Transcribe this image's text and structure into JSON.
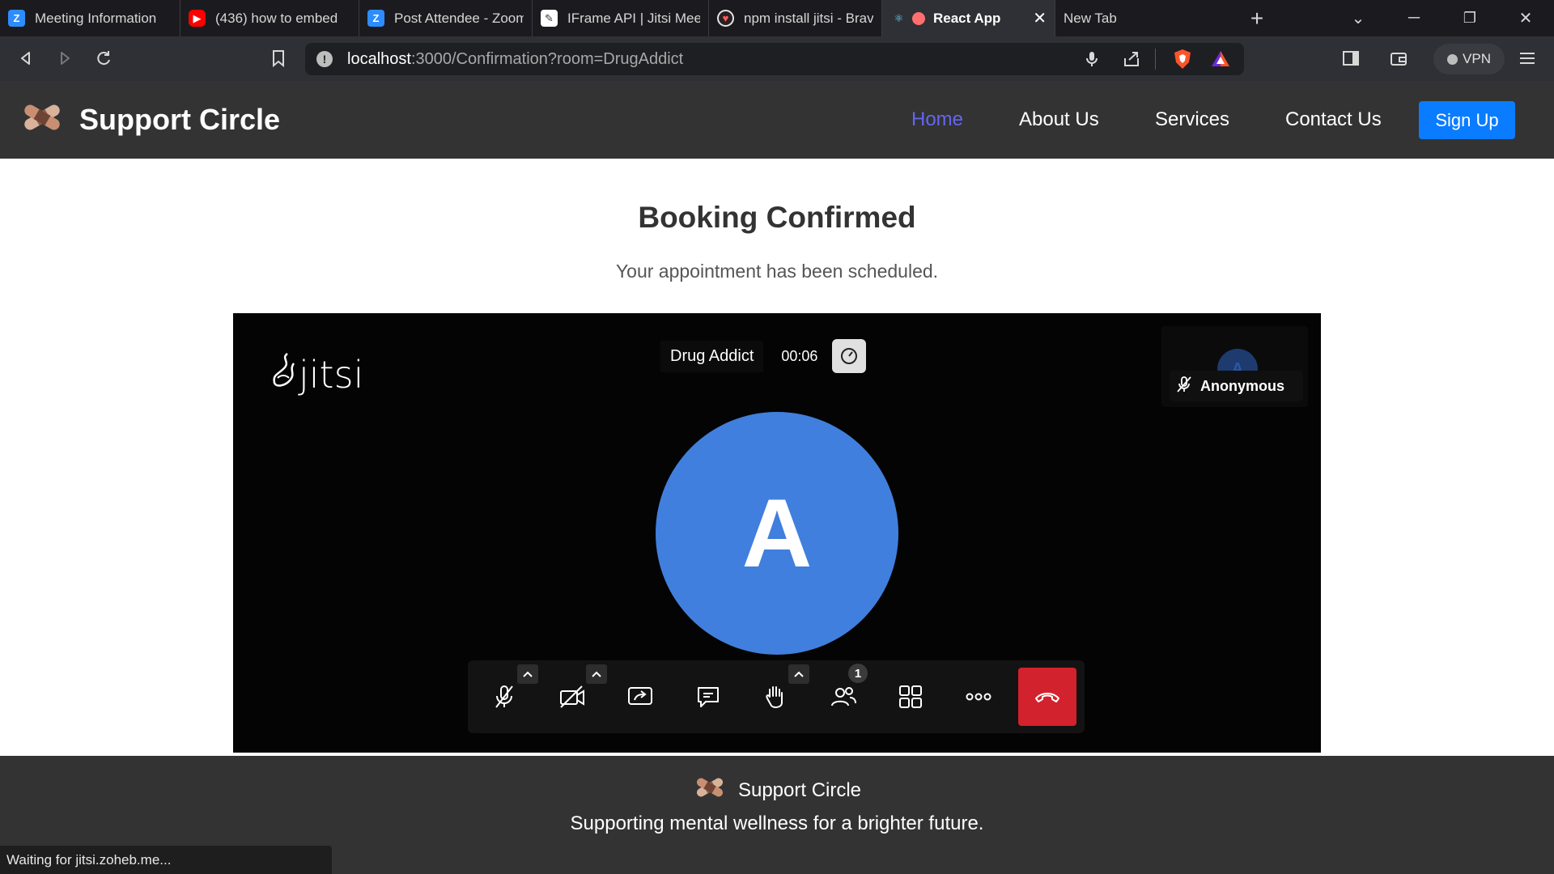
{
  "browser": {
    "tabs": [
      {
        "title": "Meeting Information",
        "favicon": "zoom-icon"
      },
      {
        "title": "(436) how to embed",
        "favicon": "youtube-icon"
      },
      {
        "title": "Post Attendee - Zoom",
        "favicon": "zoom-icon"
      },
      {
        "title": "IFrame API | Jitsi Meet",
        "favicon": "jitsi-icon"
      },
      {
        "title": "npm install jitsi - Brave",
        "favicon": "brave-search-icon"
      },
      {
        "title": "React App",
        "favicon": "react-icon",
        "active": true
      },
      {
        "title": "New Tab",
        "favicon": ""
      }
    ],
    "url_host": "localhost",
    "url_rest": ":3000/Confirmation?room=DrugAddict",
    "vpn_label": "VPN",
    "status_text": "Waiting for jitsi.zoheb.me..."
  },
  "navbar": {
    "brand": "Support Circle",
    "links": [
      "Home",
      "About Us",
      "Services",
      "Contact Us"
    ],
    "active_link": "Home",
    "signup": "Sign Up"
  },
  "page": {
    "title": "Booking Confirmed",
    "subtitle": "Your appointment has been scheduled."
  },
  "meeting": {
    "logo": "jitsi",
    "room_name": "Drug Addict",
    "timer": "00:06",
    "participant_name": "Anonymous",
    "avatar_letter": "A",
    "participant_count": "1"
  },
  "footer": {
    "brand": "Support Circle",
    "tagline": "Supporting mental wellness for a brighter future."
  },
  "colors": {
    "navbar": "#333333",
    "active_link": "#6366f1",
    "signup": "#0a7cff",
    "avatar": "#407fdd",
    "hangup": "#d2222d"
  }
}
